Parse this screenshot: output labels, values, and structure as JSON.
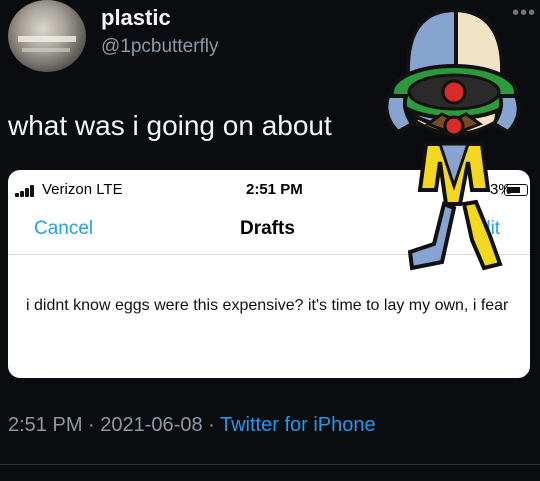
{
  "tweet": {
    "display_name": "plastic",
    "handle": "@1pcbutterfly",
    "text": "what was i going on about",
    "time": "2:51 PM",
    "date": "2021-06-08",
    "source": "Twitter for iPhone",
    "separator": " · "
  },
  "screenshot": {
    "status_bar": {
      "carrier": "Verizon  LTE",
      "time": "2:51 PM",
      "battery": "3%"
    },
    "nav": {
      "cancel_label": "Cancel",
      "title": "Drafts",
      "edit_label": "dit"
    },
    "draft_text": "i didnt know eggs were this expensive? it's time to lay my own, i fear"
  },
  "icons": {
    "more": "more-icon",
    "signal": "signal-icon",
    "battery": "battery-icon"
  },
  "colors": {
    "background": "#0b0c10",
    "link": "#1d9bf0",
    "muted": "#8b98a5"
  }
}
